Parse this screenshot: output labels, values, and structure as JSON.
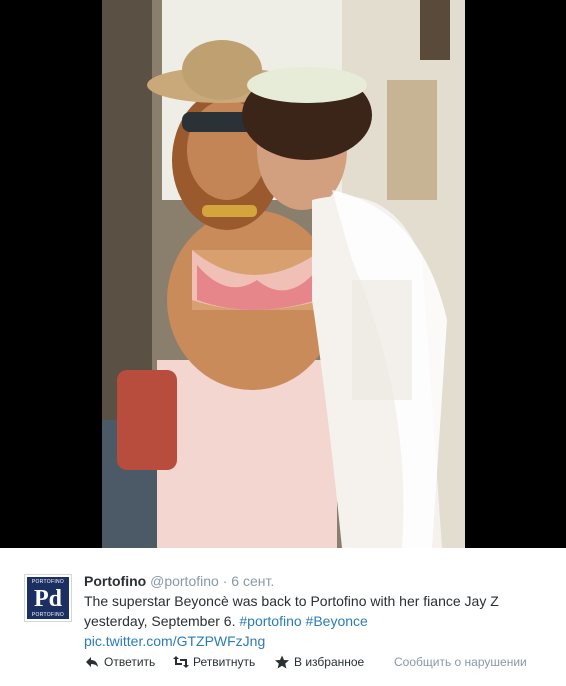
{
  "tweet": {
    "name": "Portofino",
    "handle": "@portofino",
    "separator": "·",
    "time": "6 сент.",
    "text_main": "The superstar Beyoncè was back to Portofino with her fiance Jay Z yesterday, September 6.",
    "hashtag1": "#portofino",
    "hashtag2": "#Beyonce",
    "pic_link": "pic.twitter.com/GTZPWFzJng"
  },
  "avatar": {
    "top_text": "PORTOFINO",
    "mark": "Pd",
    "bottom_text": "PORTOFINO"
  },
  "actions": {
    "reply_label": "Ответить",
    "retweet_label": "Ретвитнуть",
    "favorite_label": "В избранное",
    "report_label": "Сообщить о нарушении"
  },
  "icons": {
    "reply": "reply-icon",
    "retweet": "retweet-icon",
    "favorite": "star-icon"
  },
  "colors": {
    "link": "#2b7bb9",
    "text": "#292f33",
    "muted": "#8899a6",
    "avatar_bg": "#1c2f63"
  }
}
